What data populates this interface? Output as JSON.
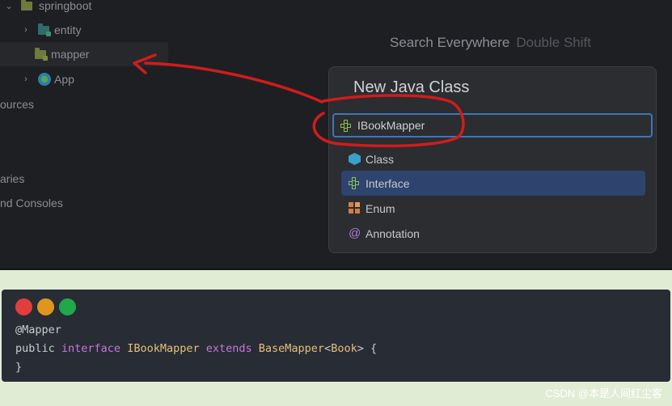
{
  "project_tree": {
    "items": [
      {
        "label": "springboot",
        "kind": "folder"
      },
      {
        "label": "entity",
        "kind": "package"
      },
      {
        "label": "mapper",
        "kind": "package",
        "selected": true
      },
      {
        "label": "App",
        "kind": "class"
      },
      {
        "label": "ources"
      },
      {
        "label": "aries"
      },
      {
        "label": "nd Consoles"
      }
    ]
  },
  "search_hint": {
    "text": "Search Everywhere",
    "shortcut": "Double Shift"
  },
  "new_class_popup": {
    "title": "New Java Class",
    "input_value": "IBookMapper",
    "options": [
      {
        "label": "Class",
        "icon": "class-icon"
      },
      {
        "label": "Interface",
        "icon": "interface-icon",
        "selected": true
      },
      {
        "label": "Enum",
        "icon": "enum-icon"
      },
      {
        "label": "Annotation",
        "icon": "annotation-icon"
      }
    ]
  },
  "code_block": {
    "window_dots": [
      "#e03e3e",
      "#e0961d",
      "#21a84a"
    ],
    "lines": [
      [
        {
          "text": "@Mapper",
          "color": "#c8ccd2"
        }
      ],
      [
        {
          "text": "public ",
          "color": "#c8ccd2"
        },
        {
          "text": "interface ",
          "color": "#c678dd"
        },
        {
          "text": "IBookMapper ",
          "color": "#e5c07b"
        },
        {
          "text": "extends ",
          "color": "#c678dd"
        },
        {
          "text": "BaseMapper",
          "color": "#e5c07b"
        },
        {
          "text": "<",
          "color": "#c8ccd2"
        },
        {
          "text": "Book",
          "color": "#e5c07b"
        },
        {
          "text": "> {",
          "color": "#c8ccd2"
        }
      ],
      [
        {
          "text": "}",
          "color": "#c8ccd2"
        }
      ]
    ]
  },
  "annotation_color": "#d01c1c",
  "watermark": "CSDN @本是人间红尘客"
}
